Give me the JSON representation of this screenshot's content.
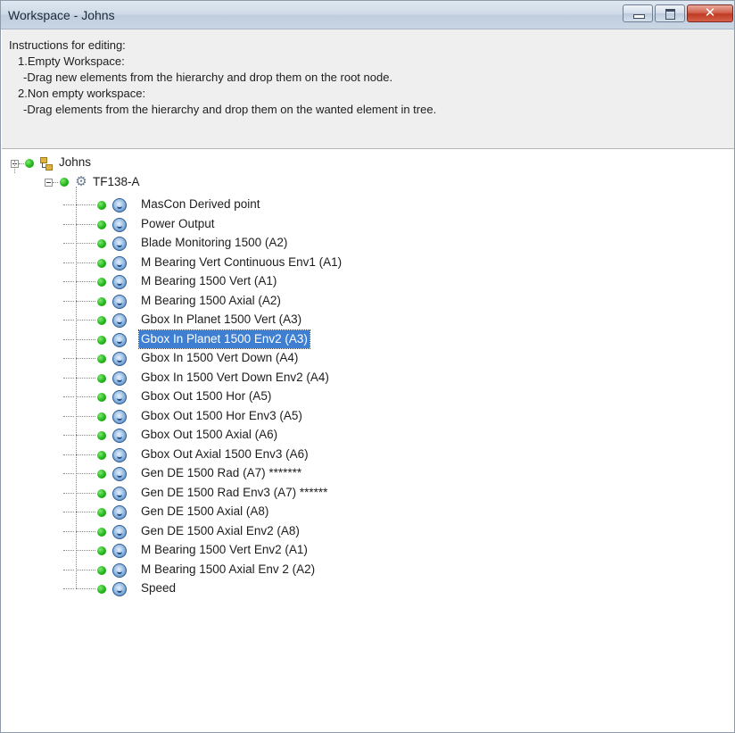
{
  "window": {
    "title": "Workspace - Johns",
    "minimize_label": "",
    "maximize_label": "",
    "close_label": "✕"
  },
  "instructions": {
    "heading": "Instructions for editing:",
    "step1_title": "1.Empty Workspace:",
    "step1_text": "-Drag new elements from the hierarchy and drop them on the root node.",
    "step2_title": "2.Non empty workspace:",
    "step2_text": "-Drag elements from the hierarchy and drop them on the wanted element in tree."
  },
  "tree": {
    "root": {
      "label": "Johns",
      "status_color": "#22b61c",
      "icon": "workspace-hierarchy-icon"
    },
    "machine": {
      "label": "TF138-A",
      "status_color": "#22b61c",
      "icon": "machine-gear-icon"
    },
    "selected_index": 7,
    "points": [
      {
        "label": "MasCon Derived point"
      },
      {
        "label": "Power Output"
      },
      {
        "label": "Blade Monitoring 1500 (A2)"
      },
      {
        "label": "M Bearing Vert Continuous Env1 (A1)"
      },
      {
        "label": "M Bearing 1500 Vert (A1)"
      },
      {
        "label": "M Bearing 1500 Axial (A2)"
      },
      {
        "label": "Gbox In Planet 1500 Vert (A3)"
      },
      {
        "label": "Gbox In Planet 1500 Env2 (A3)"
      },
      {
        "label": "Gbox In 1500 Vert Down (A4)"
      },
      {
        "label": "Gbox In 1500 Vert Down Env2 (A4)"
      },
      {
        "label": "Gbox Out 1500 Hor (A5)"
      },
      {
        "label": "Gbox Out 1500 Hor Env3 (A5)"
      },
      {
        "label": "Gbox Out 1500 Axial (A6)"
      },
      {
        "label": "Gbox Out Axial 1500 Env3 (A6)"
      },
      {
        "label": "Gen DE 1500 Rad (A7) *******"
      },
      {
        "label": "Gen DE 1500 Rad Env3 (A7) ******"
      },
      {
        "label": "Gen DE 1500 Axial (A8)"
      },
      {
        "label": "Gen DE 1500 Axial Env2 (A8)"
      },
      {
        "label": "M Bearing 1500 Vert Env2  (A1)"
      },
      {
        "label": "M Bearing 1500 Axial Env 2  (A2)"
      },
      {
        "label": "Speed"
      }
    ]
  }
}
